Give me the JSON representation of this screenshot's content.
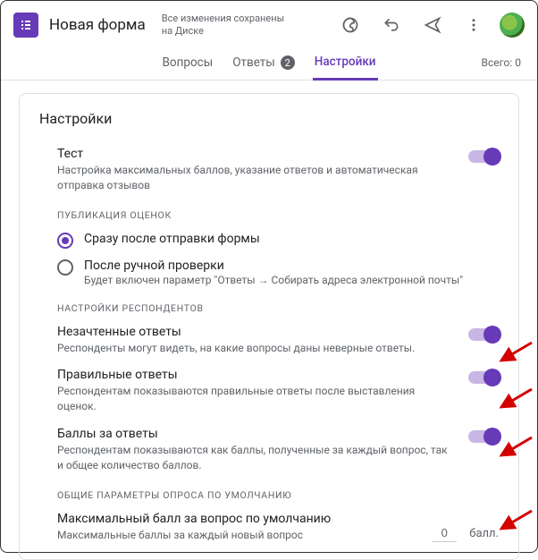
{
  "header": {
    "title": "Новая форма",
    "save_status_line1": "Все изменения сохранены",
    "save_status_line2": "на Диске"
  },
  "tabs": {
    "questions": "Вопросы",
    "answers": "Ответы",
    "answers_count": "2",
    "settings": "Настройки",
    "total_label": "Всего: 0"
  },
  "card": {
    "title": "Настройки"
  },
  "quiz": {
    "title": "Тест",
    "desc": "Настройка максимальных баллов, указание ответов и автоматическая отправка отзывов"
  },
  "grades": {
    "header": "ПУБЛИКАЦИЯ ОЦЕНОК",
    "opt1_label": "Сразу после отправки формы",
    "opt2_label": "После ручной проверки",
    "opt2_sub": "Будет включен параметр \"Ответы → Собирать адреса электронной почты\""
  },
  "respondent": {
    "header": "НАСТРОЙКИ РЕСПОНДЕНТОВ",
    "missed_title": "Незачтенные ответы",
    "missed_desc": "Респонденты могут видеть, на какие вопросы даны неверные ответы.",
    "correct_title": "Правильные ответы",
    "correct_desc": "Респондентам показываются правильные ответы после выставления оценок.",
    "points_title": "Баллы за ответы",
    "points_desc": "Респондентам показываются как баллы, полученные за каждый вопрос, так и общее количество баллов."
  },
  "defaults": {
    "header": "ОБЩИЕ ПАРАМЕТРЫ ОПРОСА ПО УМОЛЧАНИЮ",
    "maxpoints_title": "Максимальный балл за вопрос по умолчанию",
    "maxpoints_desc": "Максимальные баллы за каждый новый вопрос",
    "value": "0",
    "unit": "балл."
  }
}
